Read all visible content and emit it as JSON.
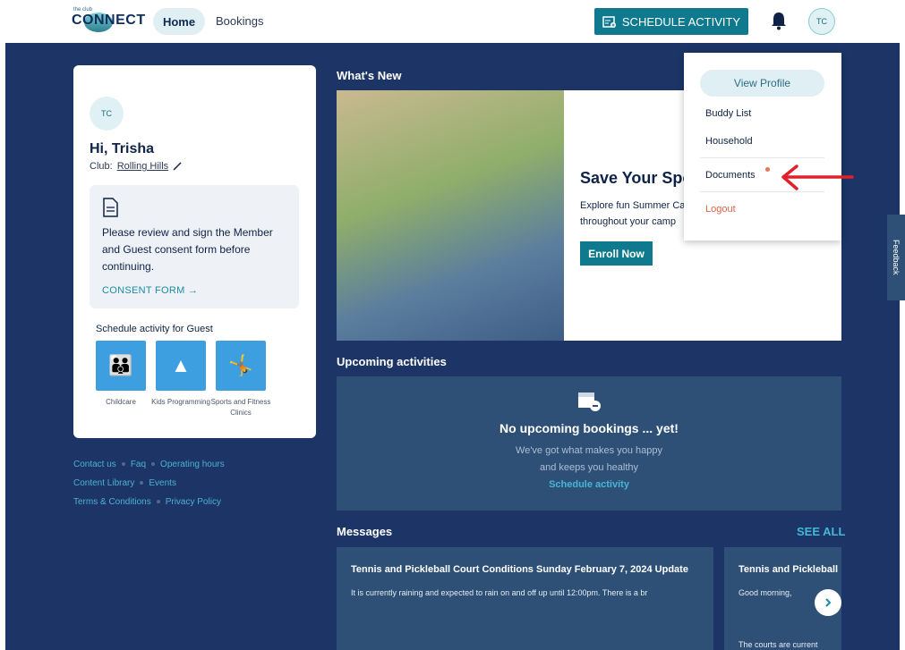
{
  "header": {
    "logo_small": "the club",
    "logo_text": "CONNECT",
    "nav": [
      "Home",
      "Bookings"
    ],
    "schedule_label": "SCHEDULE ACTIVITY",
    "avatar_initials": "TC"
  },
  "profile": {
    "initials": "TC",
    "greeting": "Hi, Trisha",
    "club_label": "Club:",
    "club_name": "Rolling Hills"
  },
  "consent": {
    "message": "Please review and sign the Member and Guest consent form before continuing.",
    "link": "CONSENT FORM →"
  },
  "guest": {
    "title": "Schedule activity for Guest",
    "options": [
      "Childcare",
      "Kids Programming",
      "Sports and Fitness Clinics"
    ]
  },
  "footer": {
    "row1": [
      "Contact us",
      "Faq",
      "Operating hours"
    ],
    "row2": [
      "Content Library",
      "Events"
    ],
    "row3": [
      "Terms & Conditions",
      "Privacy Policy"
    ]
  },
  "whats_new": {
    "title": "What's New",
    "promo_title": "Save Your Spot",
    "promo_desc": "Explore fun Summer Camp throughout your camp",
    "enroll_label": "Enroll Now"
  },
  "upcoming": {
    "title": "Upcoming activities",
    "empty_title": "No upcoming bookings ... yet!",
    "empty_sub1": "We've got what makes you happy",
    "empty_sub2": "and keeps you healthy",
    "link": "Schedule activity"
  },
  "messages": {
    "title": "Messages",
    "see_all": "SEE ALL",
    "cards": [
      {
        "title": "Tennis and Pickleball Court Conditions Sunday February 7, 2024 Update",
        "body": "It is currently raining and expected to rain on and off up until 12:00pm. There is a br",
        "body2": ""
      },
      {
        "title": "Tennis and Pickleball",
        "body": "Good morning,",
        "body2": "The courts are current"
      }
    ]
  },
  "menu": {
    "view_profile": "View Profile",
    "items": [
      "Buddy List",
      "Household",
      "Documents"
    ],
    "logout": "Logout"
  },
  "feedback_label": "Feedback"
}
